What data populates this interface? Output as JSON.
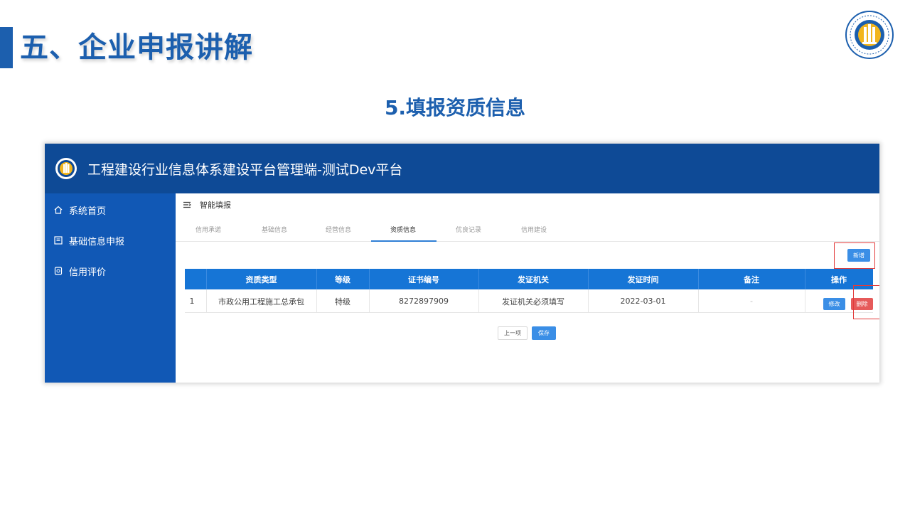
{
  "slide": {
    "title": "五、企业申报讲解",
    "subtitle": "5.填报资质信息"
  },
  "app": {
    "title": "工程建设行业信息体系建设平台管理端-测试Dev平台",
    "header_color": "#0e4a96",
    "sidebar_color": "#1158b5",
    "accent_color": "#3a8ee6"
  },
  "sidebar": {
    "items": [
      {
        "label": "系统首页",
        "icon": "home-icon"
      },
      {
        "label": "基础信息申报",
        "icon": "form-icon"
      },
      {
        "label": "信用评价",
        "icon": "credit-icon"
      }
    ]
  },
  "breadcrumb": {
    "label": "智能填报",
    "icon": "menu-icon"
  },
  "tabs": [
    {
      "label": "信用承诺",
      "active": false
    },
    {
      "label": "基础信息",
      "active": false
    },
    {
      "label": "经营信息",
      "active": false
    },
    {
      "label": "资质信息",
      "active": true
    },
    {
      "label": "优良记录",
      "active": false
    },
    {
      "label": "信用建设",
      "active": false
    }
  ],
  "toolbar": {
    "add_label": "新增"
  },
  "table": {
    "headers": [
      "",
      "资质类型",
      "等级",
      "证书编号",
      "发证机关",
      "发证时间",
      "备注",
      "操作"
    ],
    "rows": [
      {
        "index": "1",
        "type": "市政公用工程施工总承包",
        "level": "特级",
        "cert_no": "8272897909",
        "authority": "发证机关必须填写",
        "date": "2022-03-01",
        "remark": "-",
        "edit_label": "修改",
        "delete_label": "删除"
      }
    ]
  },
  "footer": {
    "prev_label": "上一项",
    "save_label": "保存"
  }
}
